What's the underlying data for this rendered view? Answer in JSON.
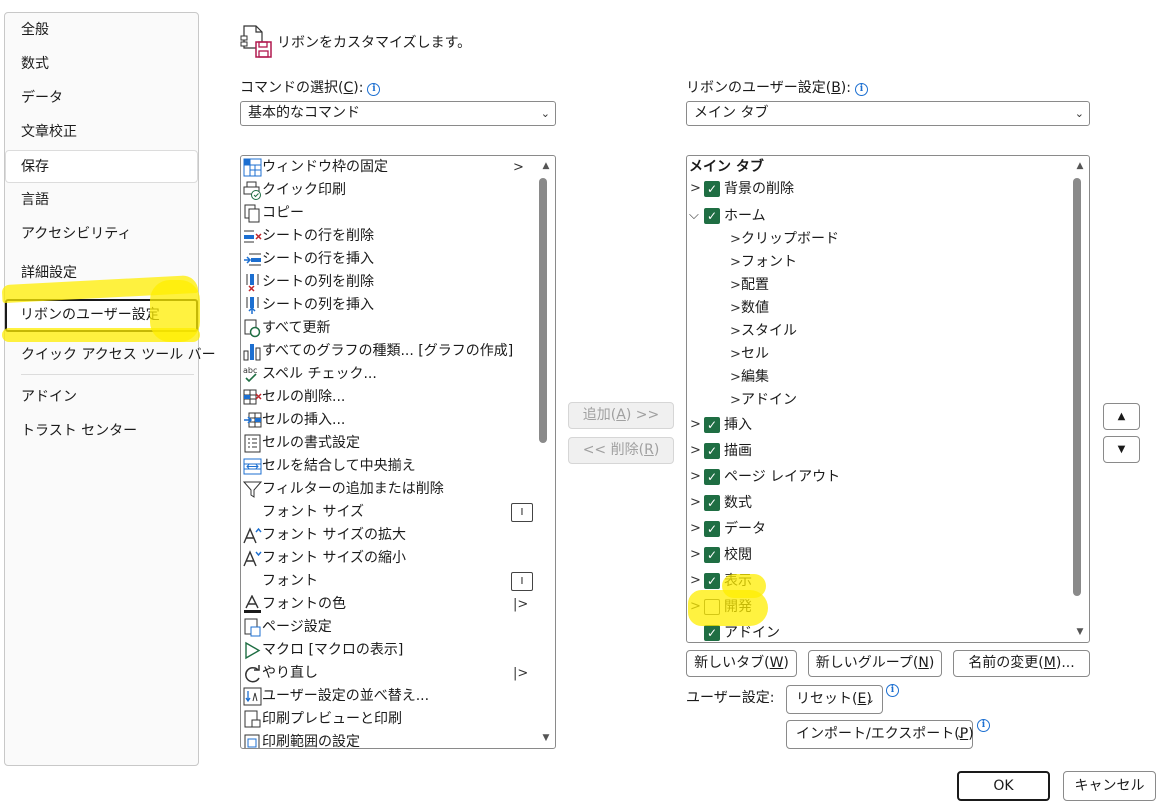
{
  "nav": {
    "items": [
      {
        "label": "全般"
      },
      {
        "label": "数式"
      },
      {
        "label": "データ"
      },
      {
        "label": "文章校正"
      },
      {
        "label": "保存"
      },
      {
        "label": "言語"
      },
      {
        "label": "アクセシビリティ"
      },
      {
        "label": "詳細設定"
      },
      {
        "label": "リボンのユーザー設定"
      },
      {
        "label": "クイック アクセス ツール バー"
      },
      {
        "label": "アドイン"
      },
      {
        "label": "トラスト センター"
      }
    ]
  },
  "header": {
    "title": "リボンをカスタマイズします。"
  },
  "left_panel": {
    "label_main": "コマンドの選択(",
    "label_key": "C",
    "label_end": "):",
    "combo_value": "基本的なコマンド",
    "commands": [
      {
        "label": "ウィンドウ枠の固定",
        "icon": "freeze-panes-icon"
      },
      {
        "label": "クイック印刷",
        "icon": "quick-print-icon"
      },
      {
        "label": "コピー",
        "icon": "copy-icon"
      },
      {
        "label": "シートの行を削除",
        "icon": "delete-row-icon"
      },
      {
        "label": "シートの行を挿入",
        "icon": "insert-row-icon"
      },
      {
        "label": "シートの列を削除",
        "icon": "delete-column-icon"
      },
      {
        "label": "シートの列を挿入",
        "icon": "insert-column-icon"
      },
      {
        "label": "すべて更新",
        "icon": "refresh-all-icon"
      },
      {
        "label": "すべてのグラフの種類... [グラフの作成]",
        "icon": "chart-icon"
      },
      {
        "label": "スペル チェック...",
        "icon": "spell-check-icon"
      },
      {
        "label": "セルの削除...",
        "icon": "delete-cells-icon"
      },
      {
        "label": "セルの挿入...",
        "icon": "insert-cells-icon"
      },
      {
        "label": "セルの書式設定",
        "icon": "format-cells-icon"
      },
      {
        "label": "セルを結合して中央揃え",
        "icon": "merge-center-icon"
      },
      {
        "label": "フィルターの追加または削除",
        "icon": "filter-icon"
      },
      {
        "label": "フォント サイズ",
        "icon": ""
      },
      {
        "label": "フォント サイズの拡大",
        "icon": "font-grow-icon"
      },
      {
        "label": "フォント サイズの縮小",
        "icon": "font-shrink-icon"
      },
      {
        "label": "フォント",
        "icon": ""
      },
      {
        "label": "フォントの色",
        "icon": "font-color-icon"
      },
      {
        "label": "ページ設定",
        "icon": "page-setup-icon"
      },
      {
        "label": "マクロ [マクロの表示]",
        "icon": "macro-icon"
      },
      {
        "label": "やり直し",
        "icon": "redo-icon"
      },
      {
        "label": "ユーザー設定の並べ替え...",
        "icon": "custom-sort-icon"
      },
      {
        "label": "印刷プレビューと印刷",
        "icon": "print-preview-icon"
      },
      {
        "label": "印刷範囲の設定",
        "icon": "print-area-icon"
      }
    ],
    "abc_glyph": "abc",
    "font_size_control": "I"
  },
  "middle": {
    "add_main": "追加(",
    "add_key": "A",
    "add_end": ") >>",
    "remove_main": "<< 削除(",
    "remove_key": "R",
    "remove_end": ")"
  },
  "right_panel": {
    "label_main": "リボンのユーザー設定(",
    "label_key": "B",
    "label_end": "):",
    "combo_value": "メイン タブ",
    "tree_header": "メイン タブ",
    "tree": [
      {
        "label": "背景の削除",
        "checked": true,
        "expanded": false,
        "level": 0
      },
      {
        "label": "ホーム",
        "checked": true,
        "expanded": true,
        "level": 0
      },
      {
        "label": "クリップボード",
        "level": 1
      },
      {
        "label": "フォント",
        "level": 1
      },
      {
        "label": "配置",
        "level": 1
      },
      {
        "label": "数値",
        "level": 1
      },
      {
        "label": "スタイル",
        "level": 1
      },
      {
        "label": "セル",
        "level": 1
      },
      {
        "label": "編集",
        "level": 1
      },
      {
        "label": "アドイン",
        "level": 1
      },
      {
        "label": "挿入",
        "checked": true,
        "expanded": false,
        "level": 0
      },
      {
        "label": "描画",
        "checked": true,
        "expanded": false,
        "level": 0
      },
      {
        "label": "ページ レイアウト",
        "checked": true,
        "expanded": false,
        "level": 0
      },
      {
        "label": "数式",
        "checked": true,
        "expanded": false,
        "level": 0
      },
      {
        "label": "データ",
        "checked": true,
        "expanded": false,
        "level": 0
      },
      {
        "label": "校閲",
        "checked": true,
        "expanded": false,
        "level": 0
      },
      {
        "label": "表示",
        "checked": true,
        "expanded": false,
        "level": 0
      },
      {
        "label": "開発",
        "checked": false,
        "expanded": false,
        "level": 0
      },
      {
        "label": "アドイン",
        "checked": true,
        "expanded": false,
        "level": 0
      }
    ],
    "new_tab": {
      "main": "新しいタブ(",
      "key": "W",
      "end": ")"
    },
    "new_group": {
      "main": "新しいグループ(",
      "key": "N",
      "end": ")"
    },
    "rename": {
      "main": "名前の変更(",
      "key": "M",
      "end": ")..."
    },
    "user_settings_label": "ユーザー設定:",
    "reset": {
      "main": "リセット(",
      "key": "E",
      "end": ")"
    },
    "import_export": {
      "main": "インポート/エクスポート(",
      "key": "P",
      "end": ")"
    },
    "info_glyph": "i",
    "checkmark": "✓"
  },
  "footer": {
    "ok": "OK",
    "cancel": "キャンセル"
  },
  "colors": {
    "check_green": "#1f6e43",
    "highlight_yellow": "#ffee00",
    "info_blue": "#1c6fd1"
  }
}
